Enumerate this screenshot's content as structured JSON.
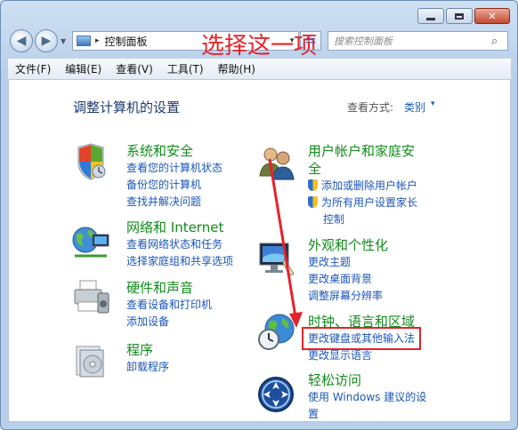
{
  "window": {
    "caption_buttons": {
      "minimize_icon": "minimize-icon",
      "maximize_icon": "maximize-icon",
      "close_label": "✕"
    }
  },
  "address": {
    "text": "控制面板",
    "separator": "▸",
    "dropdown": "▾"
  },
  "search": {
    "placeholder": "搜索控制面板"
  },
  "menu": [
    "文件(F)",
    "编辑(E)",
    "查看(V)",
    "工具(T)",
    "帮助(H)"
  ],
  "main": {
    "title": "调整计算机的设置",
    "view_by_label": "查看方式:",
    "view_by_value": "类别",
    "view_by_dd": "▾"
  },
  "categories": {
    "system": {
      "title": "系统和安全",
      "links": [
        "查看您的计算机状态",
        "备份您的计算机",
        "查找并解决问题"
      ]
    },
    "network": {
      "title": "网络和 Internet",
      "links": [
        "查看网络状态和任务",
        "选择家庭组和共享选项"
      ]
    },
    "hardware": {
      "title": "硬件和声音",
      "links": [
        "查看设备和打印机",
        "添加设备"
      ]
    },
    "programs": {
      "title": "程序",
      "links": [
        "卸载程序"
      ]
    },
    "users": {
      "title_line1": "用户帐户和家庭安",
      "title_line2": "全",
      "links": [
        "添加或删除用户帐户",
        "为所有用户设置家长",
        "控制"
      ]
    },
    "appearance": {
      "title": "外观和个性化",
      "links": [
        "更改主题",
        "更改桌面背景",
        "调整屏幕分辨率"
      ]
    },
    "clock": {
      "title": "时钟、语言和区域",
      "links": [
        "更改键盘或其他输入法",
        "更改显示语言"
      ]
    },
    "ease": {
      "title": "轻松访问",
      "links": [
        "使用 Windows 建议的设",
        "置"
      ]
    }
  },
  "annotation": {
    "text": "选择这一项",
    "color": "#e5222a"
  }
}
